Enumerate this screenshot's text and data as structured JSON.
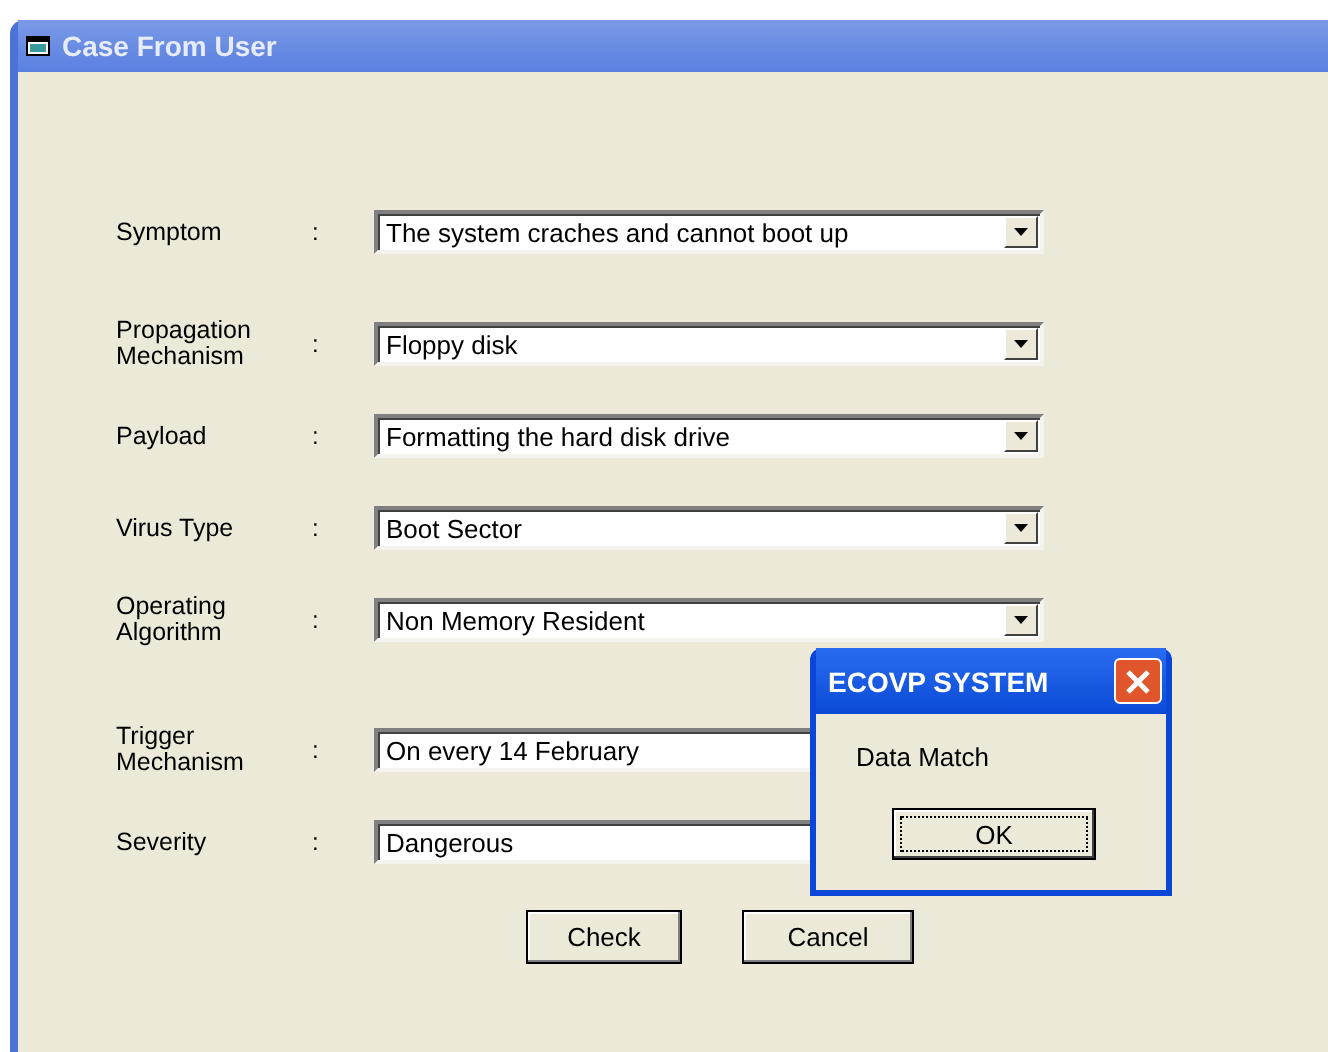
{
  "window": {
    "title": "Case From User"
  },
  "fields": [
    {
      "label": "Symptom",
      "value": "The system craches and cannot boot up"
    },
    {
      "label": "Propagation Mechanism",
      "value": "Floppy disk"
    },
    {
      "label": "Payload",
      "value": "Formatting the hard disk drive"
    },
    {
      "label": "Virus Type",
      "value": "Boot Sector"
    },
    {
      "label": "Operating Algorithm",
      "value": "Non Memory Resident"
    },
    {
      "label": "Trigger Mechanism",
      "value": "On every 14 February"
    },
    {
      "label": "Severity",
      "value": "Dangerous"
    }
  ],
  "colon": ":",
  "buttons": [
    "Check",
    "Cancel"
  ],
  "dialog": {
    "title": "ECOVP SYSTEM",
    "message": "Data Match",
    "button": "OK"
  }
}
